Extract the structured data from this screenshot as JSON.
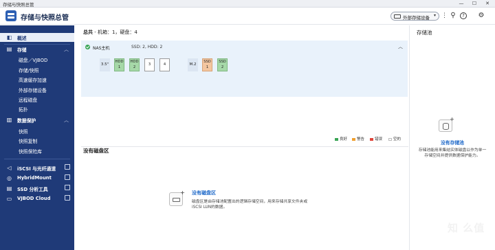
{
  "window": {
    "title": "存储与快照总管",
    "controls": [
      "—",
      "☐",
      "✕"
    ]
  },
  "app": {
    "title": "存储与快照总管",
    "external_device_label": "外部存储设备",
    "dropdown_glyph": "▾",
    "dots": "⋮",
    "search_glyph": "⚲",
    "help_glyph": "?",
    "gear_glyph": "⚙"
  },
  "sidebar": {
    "overview": {
      "icon": "◧",
      "label": "概述"
    },
    "storage": {
      "icon": "▤",
      "label": "存储",
      "arrow": "︿",
      "items": [
        "磁盘／VJBOD",
        "存储/快照",
        "高速缓存加速",
        "外部存储设备",
        "远程磁盘",
        "拓扑"
      ]
    },
    "protection": {
      "icon": "▥",
      "label": "数据保护",
      "arrow": "︿",
      "items": [
        "快照",
        "快照复制",
        "快照保险库"
      ]
    },
    "tools": [
      {
        "icon": "◁",
        "label": "iSCSI 与光纤通道"
      },
      {
        "icon": "◎",
        "label": "HybridMount"
      },
      {
        "icon": "▤",
        "label": "SSD 分析工具"
      },
      {
        "icon": "▭",
        "label": "VJBOD Cloud"
      }
    ]
  },
  "main": {
    "summary_label": "总共",
    "summary_rest": " - 机箱：1，硬盘：4",
    "nas_label": "NAS主机",
    "disk_counts": "SSD: 2, HDD: 2",
    "collapse_glyph": "︿",
    "slots_35": [
      {
        "label": "3.5\"",
        "kind": "lbl"
      },
      {
        "l1": "HDD",
        "l2": "1",
        "kind": "g"
      },
      {
        "l1": "HDD",
        "l2": "2",
        "kind": "g"
      },
      {
        "l1": "",
        "l2": "3",
        "kind": "e"
      },
      {
        "l1": "",
        "l2": "4",
        "kind": "e"
      }
    ],
    "slots_m2": [
      {
        "label": "M.2",
        "kind": "lbl"
      },
      {
        "l1": "SSD",
        "l2": "1",
        "kind": "o"
      },
      {
        "l1": "SSD",
        "l2": "2",
        "kind": "g"
      }
    ],
    "legend": [
      {
        "label": "良好",
        "color": "#3aa556"
      },
      {
        "label": "警告",
        "color": "#f0a030"
      },
      {
        "label": "错误",
        "color": "#e0453a"
      },
      {
        "label": "空的",
        "color": "#ffffff"
      }
    ],
    "no_pool_heading": "没有磁盘区",
    "empty_title": "没有磁盘区",
    "empty_plus": "+",
    "empty_desc": "磁盘区是由存储池配置出的逻辑存储空间，用来存储共享文件夹或 iSCSI LUN的数据。"
  },
  "right": {
    "heading": "存储池",
    "plus": "+",
    "pool_title": "没有存储池",
    "pool_desc": "存储池能用来集结实体磁盘以作为单一存储空间并提供数据保护能力。"
  },
  "watermark": "知 么值"
}
